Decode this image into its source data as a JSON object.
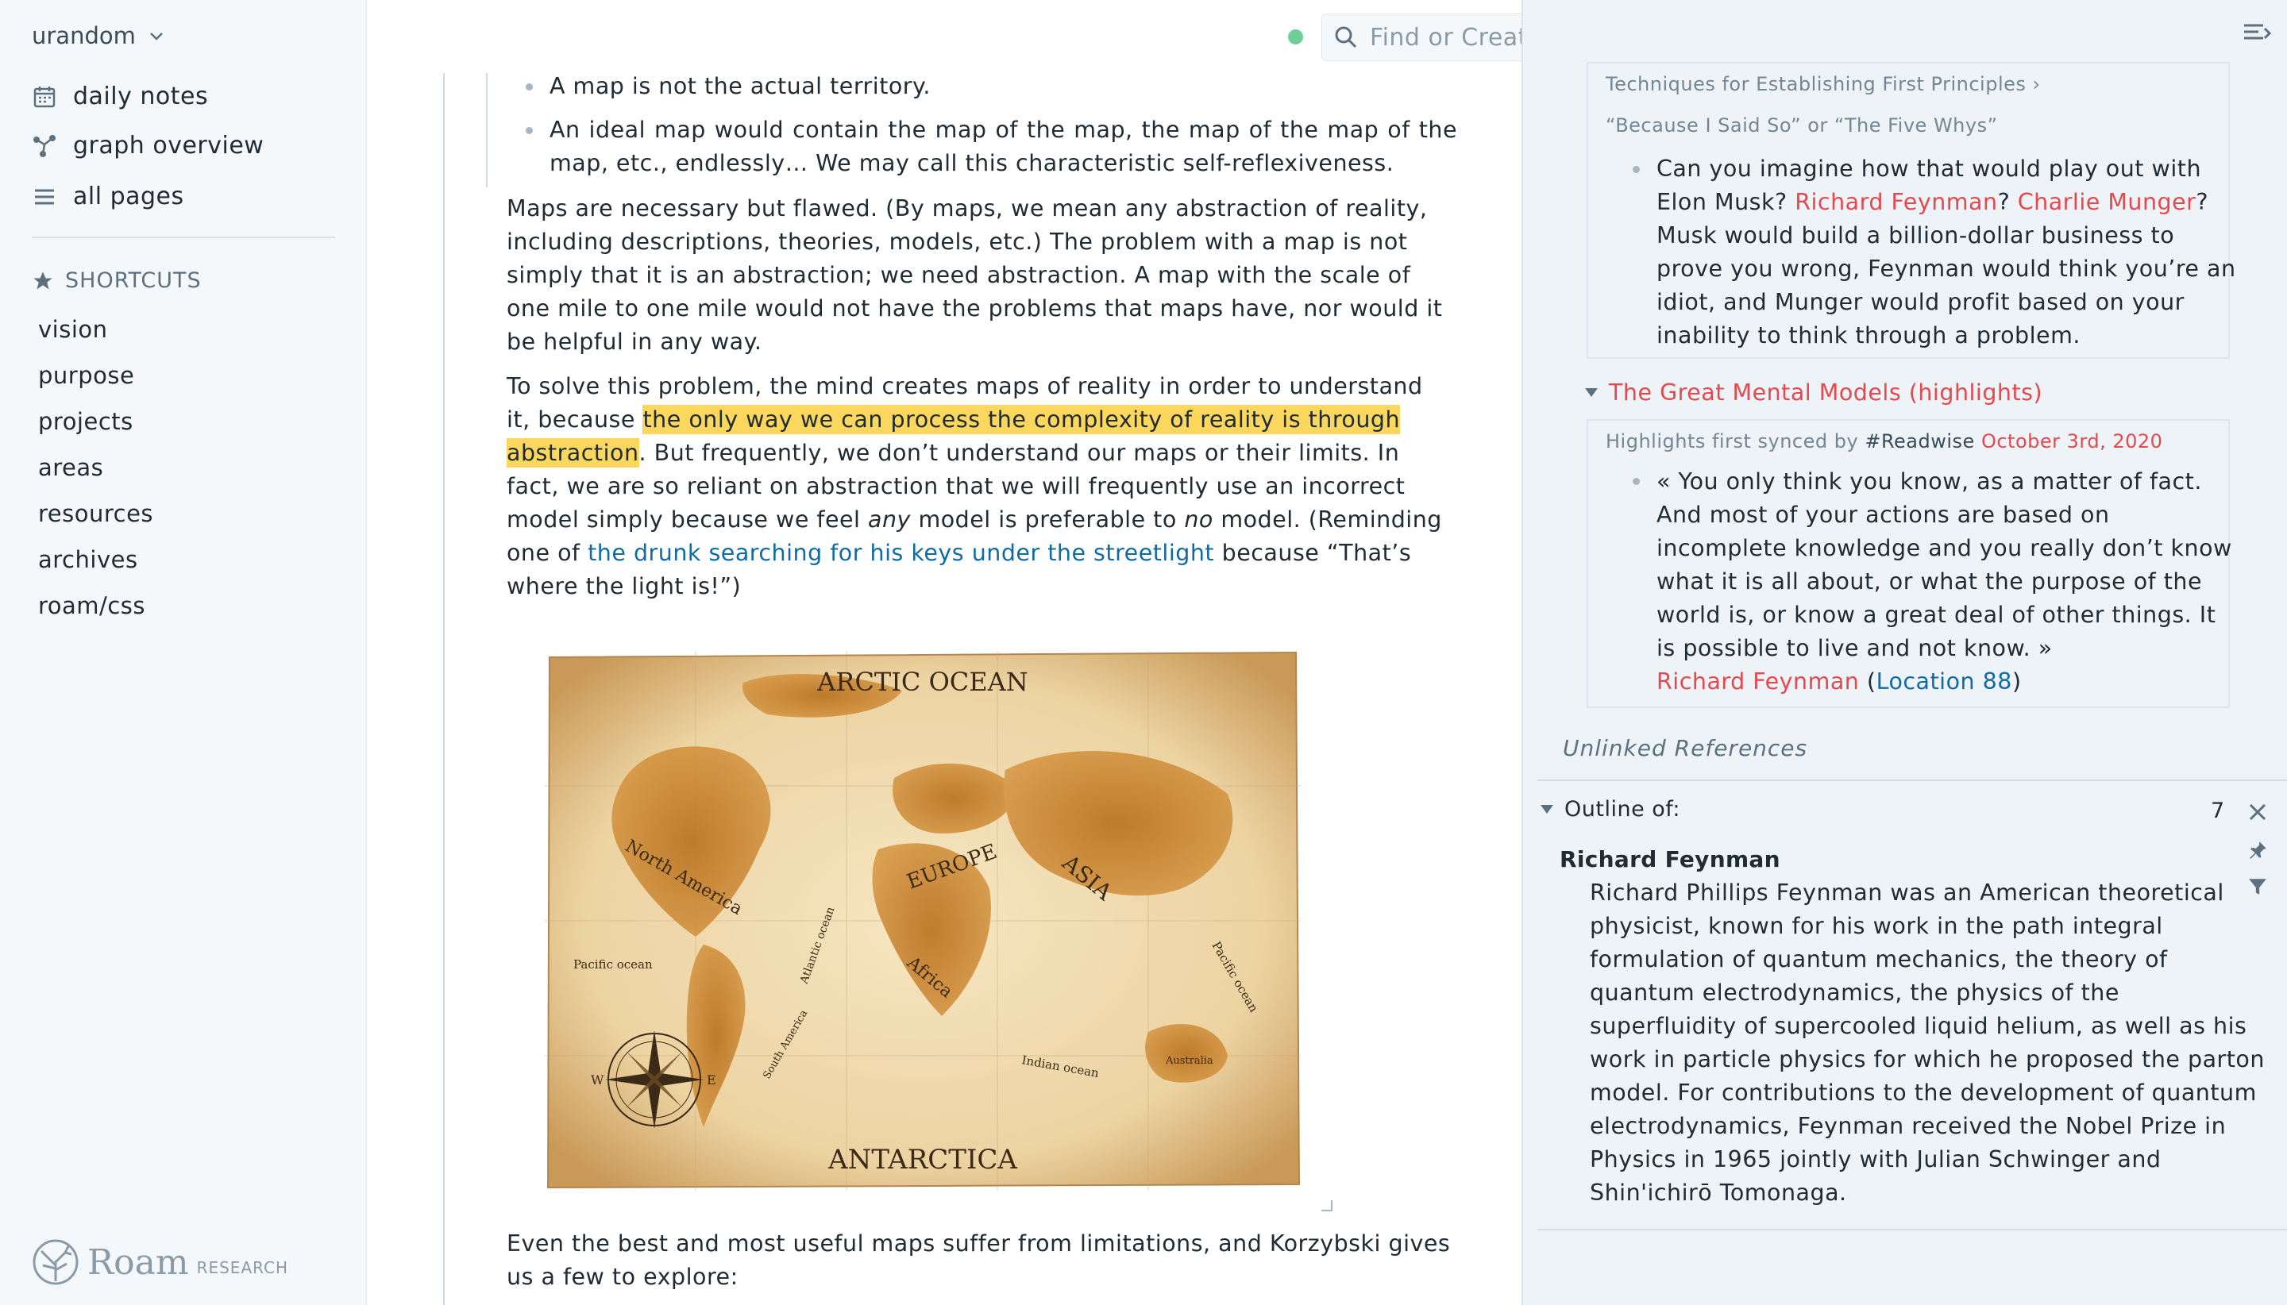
{
  "sidebar": {
    "graph_name": "urandom",
    "nav": [
      {
        "label": "daily notes",
        "icon": "calendar-icon"
      },
      {
        "label": "graph overview",
        "icon": "graph-icon"
      },
      {
        "label": "all pages",
        "icon": "list-icon"
      }
    ],
    "shortcuts_title": "SHORTCUTS",
    "shortcuts": [
      "vision",
      "purpose",
      "projects",
      "areas",
      "resources",
      "archives",
      "roam/css"
    ],
    "logo_word": "Roam",
    "logo_sub": "RESEARCH"
  },
  "topbar": {
    "search_placeholder": "Find or Create Page",
    "sync_color": "#6fcf97"
  },
  "main": {
    "bullets": [
      "A map is not the actual territory.",
      "An ideal map would contain the map of the map, the map of the map of the map, etc., endlessly… We may call this characteristic self-reflexiveness."
    ],
    "para1": "Maps are necessary but flawed. (By maps, we mean any abstraction of reality, including descriptions, theories, models, etc.) The problem with a map is not simply that it is an abstraction; we need abstraction. A map with the scale of one mile to one mile would not have the problems that maps have, nor would it be helpful in any way.",
    "para2": {
      "before": "To solve this problem, the mind creates maps of reality in order to understand it, because ",
      "highlight": "the only way we can process the complexity of reality is through abstraction",
      "mid1": ". But frequently, we don’t understand our maps or their limits. In fact, we are so reliant on abstraction that we will frequently use an incorrect model simply because we feel ",
      "em1": "any",
      "mid2": " model is preferable to ",
      "em2": "no",
      "mid3": " model. (Reminding one of ",
      "link": "the drunk searching for his keys under the streetlight",
      "after": " because “That’s where the light is!”)"
    },
    "map_labels": {
      "top": "ARCTIC OCEAN",
      "bottom": "ANTARCTICA",
      "na": "North America",
      "eu": "EUROPE",
      "asia": "ASIA",
      "africa": "Africa",
      "atl": "Atlantic ocean",
      "pac_l": "Pacific ocean",
      "pac_r": "Pacific ocean",
      "ind": "Indian ocean",
      "sa": "South America",
      "aus": "Australia",
      "compass_w": "W",
      "compass_e": "E"
    },
    "para3": "Even the best and most useful maps suffer from limitations, and Korzybski gives us a few to explore:"
  },
  "right": {
    "ref1": {
      "breadcrumb1": "Techniques for Establishing First Principles ›",
      "breadcrumb2": "“Because I Said So” or “The Five Whys”",
      "t1": "Can you imagine how that would play out with Elon Musk? ",
      "link1": "Richard Feynman",
      "t2": "? ",
      "link2": "Charlie Munger",
      "t3": "? Musk would build a billion-dollar business to prove you wrong, Feynman would think you’re an idiot, and Munger would profit based on your inability to think through a problem."
    },
    "ref2": {
      "title": "The Great Mental Models (highlights)",
      "meta_prefix": "Highlights first synced by ",
      "meta_tag": "#Readwise",
      "meta_date": "October 3rd, 2020",
      "quote": "« You only think you know, as a matter of fact. And most of your actions are based on incomplete knowledge and you really don’t know what it is all about, or what the purpose of the world is, or know a great deal of other things. It is possible to live and not know. »",
      "author": "Richard Feynman",
      "loc_open": " (",
      "loc_link": "Location 88",
      "loc_close": ")"
    },
    "unlinked": "Unlinked References",
    "outline": {
      "label": "Outline of:",
      "count": "7",
      "title": "Richard Feynman",
      "body": "Richard Phillips Feynman was an American theoretical physicist, known for his work in the path integral formulation of quantum mechanics, the theory of quantum electrodynamics, the physics of the superfluidity of supercooled liquid helium, as well as his work in particle physics for which he proposed the parton model. For contributions to the development of quantum electrodynamics, Feynman received the Nobel Prize in Physics in 1965 jointly with Julian Schwinger and Shin'ichirō Tomonaga."
    }
  }
}
